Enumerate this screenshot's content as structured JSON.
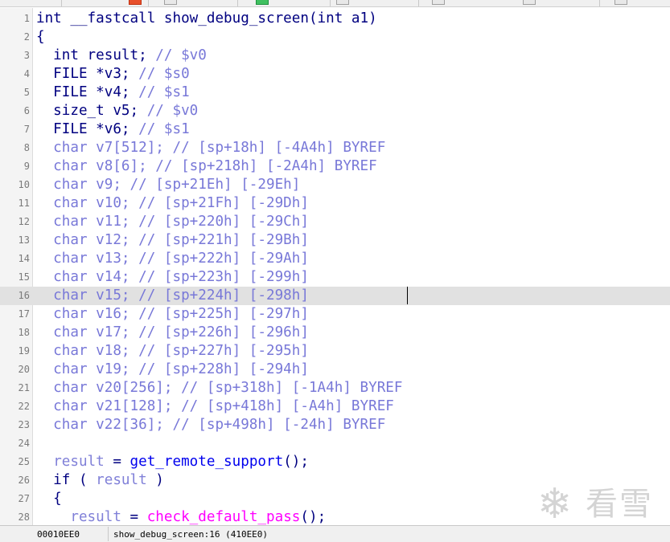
{
  "editor": {
    "lines": [
      {
        "num": "1",
        "segments": [
          {
            "t": "int __fastcall ",
            "c": "plain"
          },
          {
            "t": "show_debug_screen",
            "c": "plain"
          },
          {
            "t": "(int a1)",
            "c": "plain"
          }
        ]
      },
      {
        "num": "2",
        "segments": [
          {
            "t": "{",
            "c": "plain"
          }
        ]
      },
      {
        "num": "3",
        "segments": [
          {
            "t": "  int result; ",
            "c": "plain"
          },
          {
            "t": "// $v0",
            "c": "cmt"
          }
        ]
      },
      {
        "num": "4",
        "segments": [
          {
            "t": "  FILE *v3; ",
            "c": "plain"
          },
          {
            "t": "// $s0",
            "c": "cmt"
          }
        ]
      },
      {
        "num": "5",
        "segments": [
          {
            "t": "  FILE *v4; ",
            "c": "plain"
          },
          {
            "t": "// $s1",
            "c": "cmt"
          }
        ]
      },
      {
        "num": "6",
        "segments": [
          {
            "t": "  size_t v5; ",
            "c": "plain"
          },
          {
            "t": "// $v0",
            "c": "cmt"
          }
        ]
      },
      {
        "num": "7",
        "segments": [
          {
            "t": "  FILE *v6; ",
            "c": "plain"
          },
          {
            "t": "// $s1",
            "c": "cmt"
          }
        ]
      },
      {
        "num": "8",
        "segments": [
          {
            "t": "  char v7[512]; // [sp+18h] [-4A4h] BYREF",
            "c": "cmt"
          }
        ]
      },
      {
        "num": "9",
        "segments": [
          {
            "t": "  char v8[6]; // [sp+218h] [-2A4h] BYREF",
            "c": "cmt"
          }
        ]
      },
      {
        "num": "10",
        "segments": [
          {
            "t": "  char v9; // [sp+21Eh] [-29Eh]",
            "c": "cmt"
          }
        ]
      },
      {
        "num": "11",
        "segments": [
          {
            "t": "  char v10; // [sp+21Fh] [-29Dh]",
            "c": "cmt"
          }
        ]
      },
      {
        "num": "12",
        "segments": [
          {
            "t": "  char v11; // [sp+220h] [-29Ch]",
            "c": "cmt"
          }
        ]
      },
      {
        "num": "13",
        "segments": [
          {
            "t": "  char v12; // [sp+221h] [-29Bh]",
            "c": "cmt"
          }
        ]
      },
      {
        "num": "14",
        "segments": [
          {
            "t": "  char v13; // [sp+222h] [-29Ah]",
            "c": "cmt"
          }
        ]
      },
      {
        "num": "15",
        "segments": [
          {
            "t": "  char v14; // [sp+223h] [-299h]",
            "c": "cmt"
          }
        ]
      },
      {
        "num": "16",
        "segments": [
          {
            "t": "  char v15; // [sp+224h] [-298h]",
            "c": "cmt"
          }
        ],
        "highlighted": true
      },
      {
        "num": "17",
        "segments": [
          {
            "t": "  char v16; // [sp+225h] [-297h]",
            "c": "cmt"
          }
        ]
      },
      {
        "num": "18",
        "segments": [
          {
            "t": "  char v17; // [sp+226h] [-296h]",
            "c": "cmt"
          }
        ]
      },
      {
        "num": "19",
        "segments": [
          {
            "t": "  char v18; // [sp+227h] [-295h]",
            "c": "cmt"
          }
        ]
      },
      {
        "num": "20",
        "segments": [
          {
            "t": "  char v19; // [sp+228h] [-294h]",
            "c": "cmt"
          }
        ]
      },
      {
        "num": "21",
        "segments": [
          {
            "t": "  char v20[256]; // [sp+318h] [-1A4h] BYREF",
            "c": "cmt"
          }
        ]
      },
      {
        "num": "22",
        "segments": [
          {
            "t": "  char v21[128]; // [sp+418h] [-A4h] BYREF",
            "c": "cmt"
          }
        ]
      },
      {
        "num": "23",
        "segments": [
          {
            "t": "  char v22[36]; // [sp+498h] [-24h] BYREF",
            "c": "cmt"
          }
        ]
      },
      {
        "num": "24",
        "segments": []
      },
      {
        "num": "25",
        "segments": [
          {
            "t": "  ",
            "c": "plain"
          },
          {
            "t": "result",
            "c": "var"
          },
          {
            "t": " = ",
            "c": "plain"
          },
          {
            "t": "get_remote_support",
            "c": "fnc"
          },
          {
            "t": "();",
            "c": "plain"
          }
        ]
      },
      {
        "num": "26",
        "segments": [
          {
            "t": "  if ( ",
            "c": "plain"
          },
          {
            "t": "result",
            "c": "var"
          },
          {
            "t": " )",
            "c": "plain"
          }
        ]
      },
      {
        "num": "27",
        "segments": [
          {
            "t": "  {",
            "c": "plain"
          }
        ]
      },
      {
        "num": "28",
        "segments": [
          {
            "t": "    ",
            "c": "plain"
          },
          {
            "t": "result",
            "c": "var"
          },
          {
            "t": " = ",
            "c": "plain"
          },
          {
            "t": "check_default_pass",
            "c": "mag"
          },
          {
            "t": "();",
            "c": "plain"
          }
        ]
      }
    ]
  },
  "watermark": {
    "flake_icon": "snowflake-icon",
    "text": "看雪"
  },
  "status": {
    "address": "00010EE0",
    "location": "show_debug_screen:16 (410EE0)"
  },
  "colors": {
    "keyword": "#000080",
    "comment": "#7878d8",
    "function": "#0000ee",
    "variable": "#8080d8",
    "highlight": "#e1e1e1"
  }
}
